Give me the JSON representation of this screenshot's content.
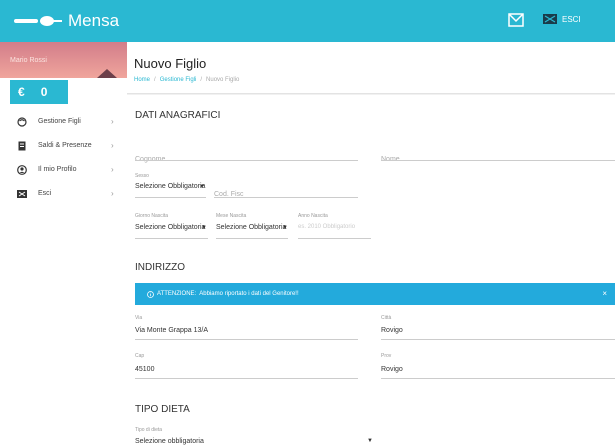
{
  "app": {
    "title": "Mensa",
    "exit_label": "ESCI",
    "brand_color": "#2ab8d2"
  },
  "sidebar": {
    "user_name": "Mario Rossi",
    "wallet": {
      "currency": "€",
      "amount": "0"
    },
    "items": [
      {
        "label": "Gestione Figli",
        "icon": "child-icon"
      },
      {
        "label": "Saldi & Presenze",
        "icon": "ledger-icon"
      },
      {
        "label": "Il mio Profilo",
        "icon": "profile-icon"
      },
      {
        "label": "Esci",
        "icon": "exit-icon"
      }
    ]
  },
  "header": {
    "title": "Nuovo Figlio",
    "breadcrumb": [
      "Home",
      "Gestione Figli",
      "Nuovo Figlio"
    ]
  },
  "form": {
    "dati_anagrafici": {
      "heading": "DATI ANAGRAFICI",
      "cognome_placeholder": "Cognome",
      "nome_placeholder": "Nome",
      "sesso_label": "Sesso",
      "sesso_value": "Selezione Obbligatoria",
      "cod_fisc_placeholder": "Cod. Fisc",
      "giorno_label": "Giorno Nascita",
      "giorno_value": "Selezione Obbligatoria",
      "mese_label": "Mese Nascita",
      "mese_value": "Selezione Obbligatoria",
      "anno_label": "Anno Nascita",
      "anno_placeholder": "es. 2010 Obbligatorio"
    },
    "indirizzo": {
      "heading": "INDIRIZZO",
      "alert_label": "ATTENZIONE:",
      "alert_text": "Abbiamo riportato i dati del Genitore!!",
      "via_label": "Via",
      "via_value": "Via Monte Grappa 13/A",
      "citta_label": "Città",
      "citta_value": "Rovigo",
      "cap_label": "Cap",
      "cap_value": "45100",
      "prov_label": "Prov",
      "prov_value": "Rovigo"
    },
    "tipo_dieta": {
      "heading": "TIPO DIETA",
      "label": "Tipo di dieta",
      "value": "Selezione obbligatoria"
    }
  }
}
